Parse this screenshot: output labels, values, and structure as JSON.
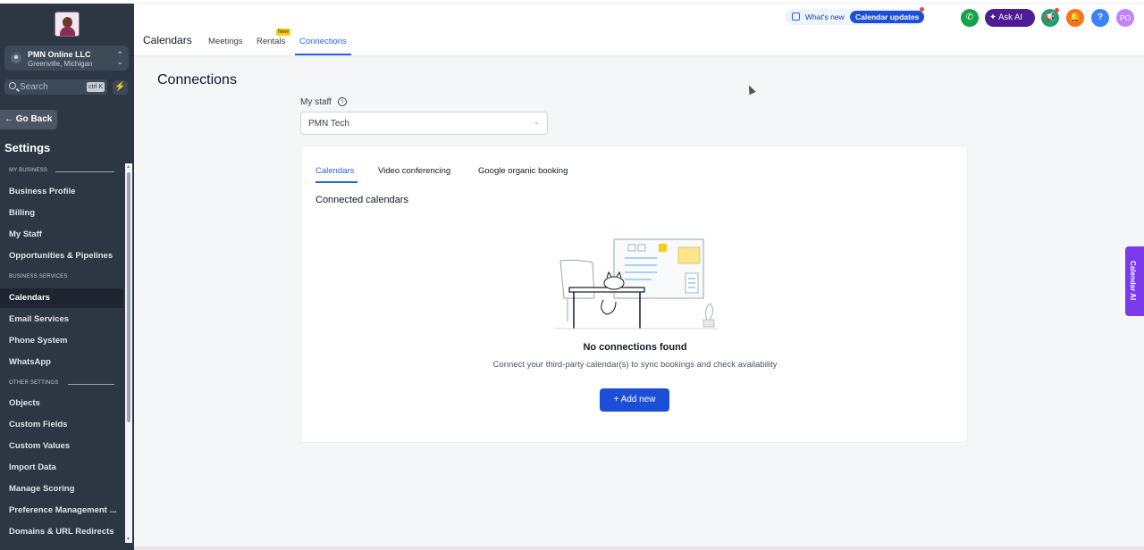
{
  "sidebar": {
    "location": {
      "name": "PMN Online LLC",
      "subtitle": "Greenville, Michigan"
    },
    "search": {
      "placeholder": "Search",
      "shortcut": "ctrl K"
    },
    "go_back": "Go Back",
    "title": "Settings",
    "sections": [
      {
        "label": "MY BUSINESS",
        "items": [
          "Business Profile",
          "Billing",
          "My Staff",
          "Opportunities & Pipelines"
        ]
      },
      {
        "label": "BUSINESS SERVICES",
        "items": [
          "Calendars",
          "Email Services",
          "Phone System",
          "WhatsApp"
        ]
      },
      {
        "label": "OTHER SETTINGS",
        "items": [
          "Objects",
          "Custom Fields",
          "Custom Values",
          "Import Data",
          "Manage Scoring",
          "Preference Management ...",
          "Domains & URL Redirects"
        ]
      }
    ],
    "active_item": "Calendars"
  },
  "header": {
    "title": "Calendars",
    "tabs": [
      {
        "label": "Meetings"
      },
      {
        "label": "Rentals",
        "badge": "New"
      },
      {
        "label": "Connections",
        "active": true
      }
    ],
    "whats_new": "What's new",
    "calendar_updates": "Calendar updates",
    "ask_ai": "Ask AI",
    "user_initials": "PO",
    "help": "?",
    "accent": "#2563eb"
  },
  "main": {
    "title": "Connections",
    "staff_label": "My staff",
    "staff_value": "PMN Tech",
    "card": {
      "tabs": [
        "Calendars",
        "Video conferencing",
        "Google organic booking"
      ],
      "active_tab": "Calendars",
      "subtitle": "Connected calendars",
      "empty_title": "No connections found",
      "empty_subtitle": "Connect your third-party calendar(s) to sync bookings and check availability",
      "add_button": "+ Add new"
    }
  },
  "side_tab": {
    "label": "Calendar AI"
  }
}
